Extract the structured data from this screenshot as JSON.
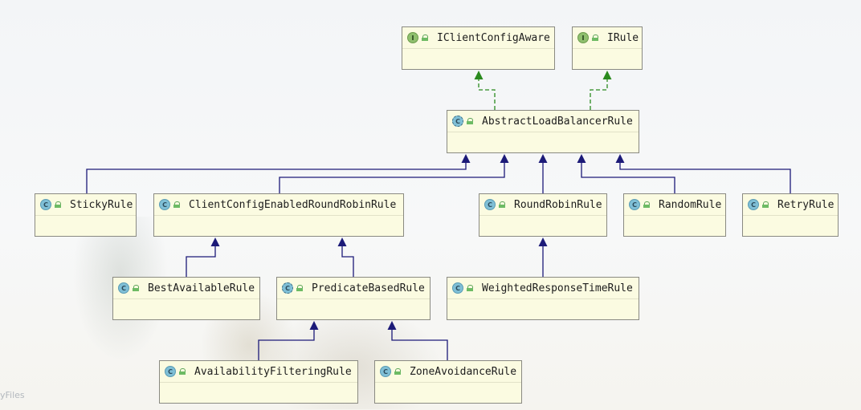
{
  "diagram": {
    "nodes": [
      {
        "id": "iclientconfigaware",
        "label": "IClientConfigAware",
        "kind": "interface",
        "kind_glyph": "I"
      },
      {
        "id": "irule",
        "label": "IRule",
        "kind": "interface",
        "kind_glyph": "I"
      },
      {
        "id": "abstractloadbalancerrule",
        "label": "AbstractLoadBalancerRule",
        "kind": "abstract-class",
        "kind_glyph": "C"
      },
      {
        "id": "stickyrule",
        "label": "StickyRule",
        "kind": "class",
        "kind_glyph": "C"
      },
      {
        "id": "clientconfigenabledroundrobinrule",
        "label": "ClientConfigEnabledRoundRobinRule",
        "kind": "class",
        "kind_glyph": "C"
      },
      {
        "id": "roundrobinrule",
        "label": "RoundRobinRule",
        "kind": "class",
        "kind_glyph": "C"
      },
      {
        "id": "randomrule",
        "label": "RandomRule",
        "kind": "class",
        "kind_glyph": "C"
      },
      {
        "id": "retryrule",
        "label": "RetryRule",
        "kind": "class",
        "kind_glyph": "C"
      },
      {
        "id": "bestavailablerule",
        "label": "BestAvailableRule",
        "kind": "class",
        "kind_glyph": "C"
      },
      {
        "id": "predicatebasedrule",
        "label": "PredicateBasedRule",
        "kind": "abstract-class",
        "kind_glyph": "C"
      },
      {
        "id": "weightedresponsetimerule",
        "label": "WeightedResponseTimeRule",
        "kind": "class",
        "kind_glyph": "C"
      },
      {
        "id": "availabilityfilteringrule",
        "label": "AvailabilityFilteringRule",
        "kind": "class",
        "kind_glyph": "C"
      },
      {
        "id": "zoneavoidancerule",
        "label": "ZoneAvoidanceRule",
        "kind": "class",
        "kind_glyph": "C"
      }
    ],
    "edges": [
      {
        "from": "abstractloadbalancerrule",
        "to": "iclientconfigaware",
        "type": "implements"
      },
      {
        "from": "abstractloadbalancerrule",
        "to": "irule",
        "type": "implements"
      },
      {
        "from": "stickyrule",
        "to": "abstractloadbalancerrule",
        "type": "extends"
      },
      {
        "from": "clientconfigenabledroundrobinrule",
        "to": "abstractloadbalancerrule",
        "type": "extends"
      },
      {
        "from": "roundrobinrule",
        "to": "abstractloadbalancerrule",
        "type": "extends"
      },
      {
        "from": "randomrule",
        "to": "abstractloadbalancerrule",
        "type": "extends"
      },
      {
        "from": "retryrule",
        "to": "abstractloadbalancerrule",
        "type": "extends"
      },
      {
        "from": "bestavailablerule",
        "to": "clientconfigenabledroundrobinrule",
        "type": "extends"
      },
      {
        "from": "predicatebasedrule",
        "to": "clientconfigenabledroundrobinrule",
        "type": "extends"
      },
      {
        "from": "weightedresponsetimerule",
        "to": "roundrobinrule",
        "type": "extends"
      },
      {
        "from": "availabilityfilteringrule",
        "to": "predicatebasedrule",
        "type": "extends"
      },
      {
        "from": "zoneavoidancerule",
        "to": "predicatebasedrule",
        "type": "extends"
      }
    ],
    "colors": {
      "extends": "#1c1a78",
      "implements": "#2a8a1e",
      "node_fill": "#fbfbe1",
      "node_border": "#8a8a82"
    },
    "icons": {
      "class": "class-icon",
      "interface": "interface-icon",
      "abstract-class": "abstract-class-icon",
      "visibility": "public-lock-icon"
    }
  },
  "watermark": "yFiles"
}
